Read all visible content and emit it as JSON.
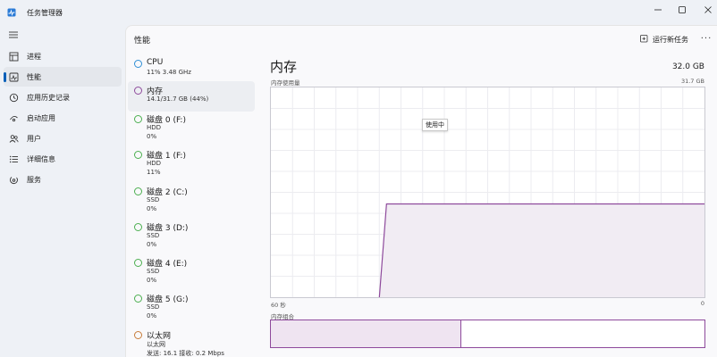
{
  "window": {
    "title": "任务管理器"
  },
  "nav": {
    "items": [
      {
        "label": "进程",
        "icon": "processes-icon"
      },
      {
        "label": "性能",
        "icon": "performance-icon"
      },
      {
        "label": "应用历史记录",
        "icon": "app-history-icon"
      },
      {
        "label": "启动应用",
        "icon": "startup-icon"
      },
      {
        "label": "用户",
        "icon": "users-icon"
      },
      {
        "label": "详细信息",
        "icon": "details-icon"
      },
      {
        "label": "服务",
        "icon": "services-icon"
      }
    ],
    "active_index": 1
  },
  "header": {
    "title": "性能",
    "run_task_label": "运行新任务",
    "more_label": "···"
  },
  "resources": [
    {
      "name": "CPU",
      "lines": [
        "11% 3.48 GHz"
      ],
      "dot_color": "#2f8fd6"
    },
    {
      "name": "内存",
      "lines": [
        "14.1/31.7 GB (44%)"
      ],
      "dot_color": "#8e4a9c"
    },
    {
      "name": "磁盘 0 (F:)",
      "lines": [
        "HDD",
        "0%"
      ],
      "dot_color": "#4caf50"
    },
    {
      "name": "磁盘 1 (F:)",
      "lines": [
        "HDD",
        "11%"
      ],
      "dot_color": "#4caf50"
    },
    {
      "name": "磁盘 2 (C:)",
      "lines": [
        "SSD",
        "0%"
      ],
      "dot_color": "#4caf50"
    },
    {
      "name": "磁盘 3 (D:)",
      "lines": [
        "SSD",
        "0%"
      ],
      "dot_color": "#4caf50"
    },
    {
      "name": "磁盘 4 (E:)",
      "lines": [
        "SSD",
        "0%"
      ],
      "dot_color": "#4caf50"
    },
    {
      "name": "磁盘 5 (G:)",
      "lines": [
        "SSD",
        "0%"
      ],
      "dot_color": "#4caf50"
    },
    {
      "name": "以太网",
      "lines": [
        "以太网",
        "发送: 16.1  接收: 0.2 Mbps"
      ],
      "dot_color": "#c77c3a"
    }
  ],
  "detail": {
    "title": "内存",
    "total": "32.0 GB",
    "usage_label": "内存使用量",
    "max_label": "31.7 GB",
    "x_left_label": "60 秒",
    "x_right_label": "0",
    "tooltip": "使用中",
    "composition_label": "内存组合",
    "usage_series": {
      "max": 31.7,
      "points": [
        null,
        null,
        null,
        null,
        null,
        null,
        null,
        null,
        null,
        null,
        null,
        null,
        null,
        null,
        null,
        null,
        14.1,
        14.1,
        14.1,
        14.1,
        14.1,
        14.1,
        14.1,
        14.1,
        14.1,
        14.1,
        14.1,
        14.1,
        14.1,
        14.1,
        14.1,
        14.1,
        14.1,
        14.1,
        14.1,
        14.1,
        14.1,
        14.1,
        14.1,
        14.1,
        14.1,
        14.1,
        14.1,
        14.1,
        14.1,
        14.1,
        14.1,
        14.1,
        14.1,
        14.1,
        14.1,
        14.1,
        14.1,
        14.1,
        14.1,
        14.1,
        14.1,
        14.1,
        14.1,
        14.1,
        14.1
      ],
      "color": "#8e4a9c"
    },
    "composition_in_use_fraction": 0.44
  }
}
